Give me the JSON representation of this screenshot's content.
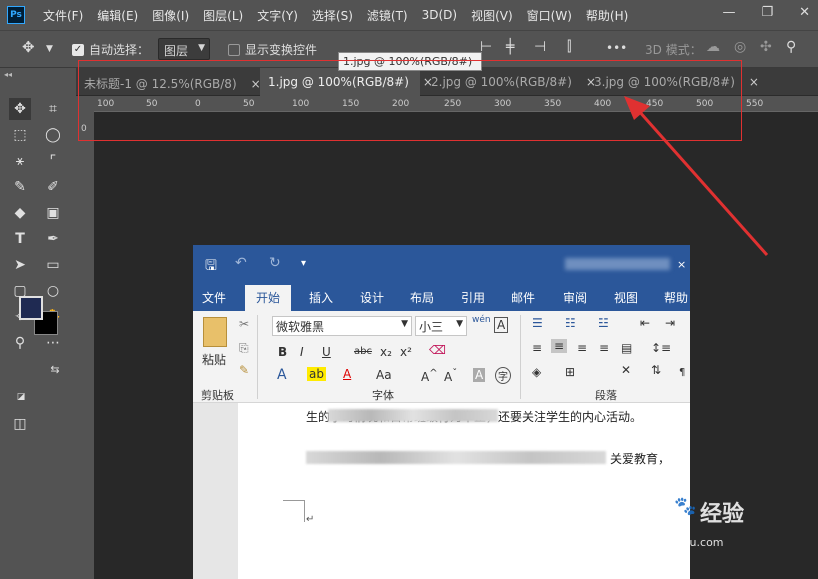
{
  "app": {
    "logo": "Ps"
  },
  "menubar": {
    "items": [
      "文件(F)",
      "编辑(E)",
      "图像(I)",
      "图层(L)",
      "文字(Y)",
      "选择(S)",
      "滤镜(T)",
      "3D(D)",
      "视图(V)",
      "窗口(W)",
      "帮助(H)"
    ],
    "window_controls": [
      "—",
      "❐",
      "✕"
    ]
  },
  "options_bar": {
    "auto_select_label": "自动选择：",
    "layer_select_value": "图层",
    "show_transform_label": "显示变换控件",
    "mode_3d_label": "3D 模式：",
    "more_label": "•••"
  },
  "tooltip": {
    "text": "1.jpg @ 100%(RGB/8#)"
  },
  "tabs": [
    {
      "label": "未标题-1 @ 12.5%(RGB/8)",
      "close": "×"
    },
    {
      "label": "1.jpg @ 100%(RGB/8#)",
      "close": "×"
    },
    {
      "label": "2.jpg @ 100%(RGB/8#)",
      "close": "×"
    },
    {
      "label": "3.jpg @ 100%(RGB/8#)",
      "close": "×"
    }
  ],
  "ruler": {
    "ticks": [
      "100",
      "50",
      "0",
      "50",
      "100",
      "150",
      "200",
      "250",
      "300",
      "350",
      "400",
      "450",
      "500",
      "550"
    ],
    "v_ticks": [
      "0"
    ]
  },
  "colors": {
    "foreground": "#1f2a52",
    "background": "#000000",
    "highlight": "#e03131",
    "word_blue": "#2b579a"
  },
  "toolbar": {
    "collapse": "◂◂"
  },
  "word": {
    "tabs": [
      "文件",
      "开始",
      "插入",
      "设计",
      "布局",
      "引用",
      "邮件",
      "审阅",
      "视图",
      "帮助"
    ],
    "font_name": "微软雅黑",
    "font_size": "小三",
    "paste_label": "粘贴",
    "groups": {
      "clipboard": "剪贴板",
      "font": "字体",
      "paragraph": "段落"
    },
    "doc_line1": "生的学习情况和日常班级行为举止，还要关注学生的内心活动。",
    "doc_line2_end": "关爱教育，",
    "para_mark": "↵",
    "format_buttons": [
      "B",
      "I",
      "U",
      "abc",
      "x₂",
      "x²"
    ]
  },
  "watermark": {
    "brand_a": "Bai",
    "brand_b": "经验",
    "url": "jingyan.baidu.com"
  }
}
